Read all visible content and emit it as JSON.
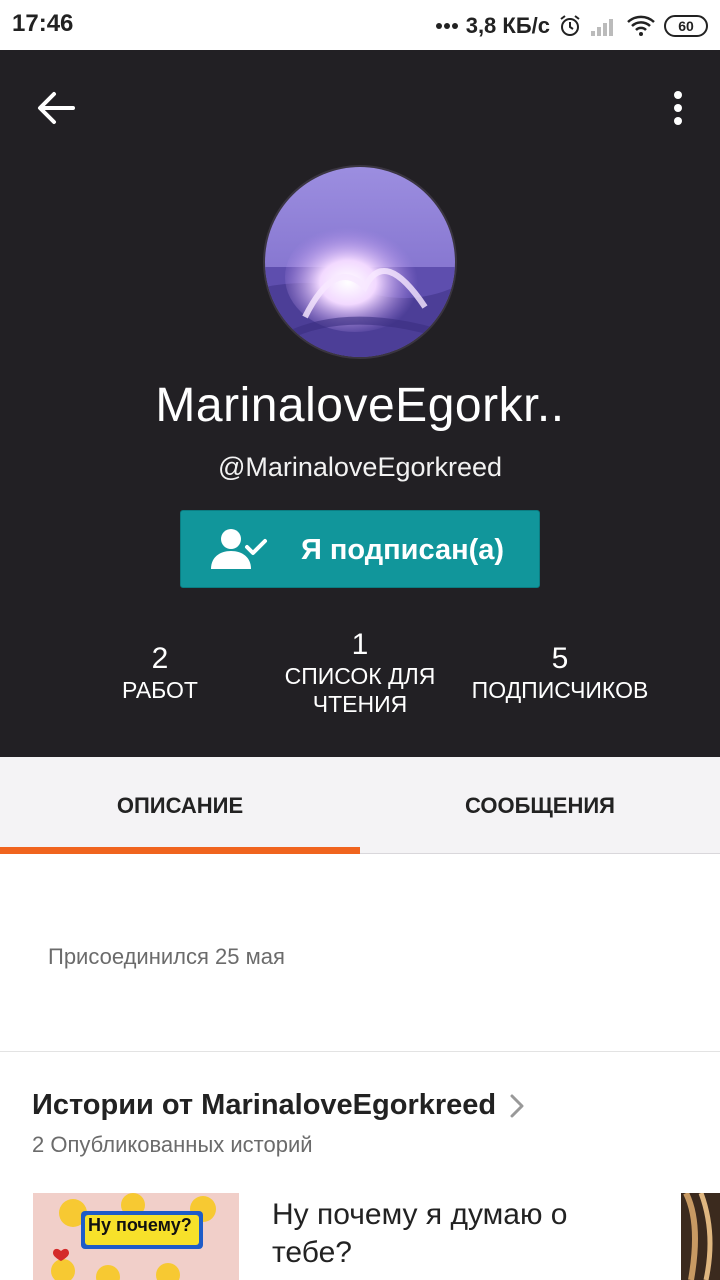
{
  "status_bar": {
    "time": "17:46",
    "net_speed": "3,8 КБ/с",
    "battery": "60",
    "icons": [
      "dots-icon",
      "alarm-icon",
      "signal-icon",
      "wifi-icon",
      "battery-icon"
    ]
  },
  "header": {
    "display_name": "MarinaloveEgorkr..",
    "username": "@MarinaloveEgorkreed",
    "follow_label": "Я подписан(а)",
    "accent_color": "#11969b",
    "stats": [
      {
        "num": "2",
        "label": "РАБОТ"
      },
      {
        "num": "1",
        "label_line1": "СПИСОК ДЛЯ",
        "label_line2": "ЧТЕНИЯ"
      },
      {
        "num": "5",
        "label": "ПОДПИСЧИКОВ"
      }
    ]
  },
  "tabs": {
    "about": "ОПИСАНИЕ",
    "messages": "СООБЩЕНИЯ",
    "indicator_color": "#f0641e"
  },
  "about": {
    "joined": "Присоединился 25 мая"
  },
  "stories": {
    "title": "Истории от MarinaloveEgorkreed",
    "subtitle": "2 Опубликованных историй",
    "items": [
      {
        "title": "Ну почему я думаю о тебе?",
        "cover_text": "Ну почему?"
      }
    ]
  }
}
